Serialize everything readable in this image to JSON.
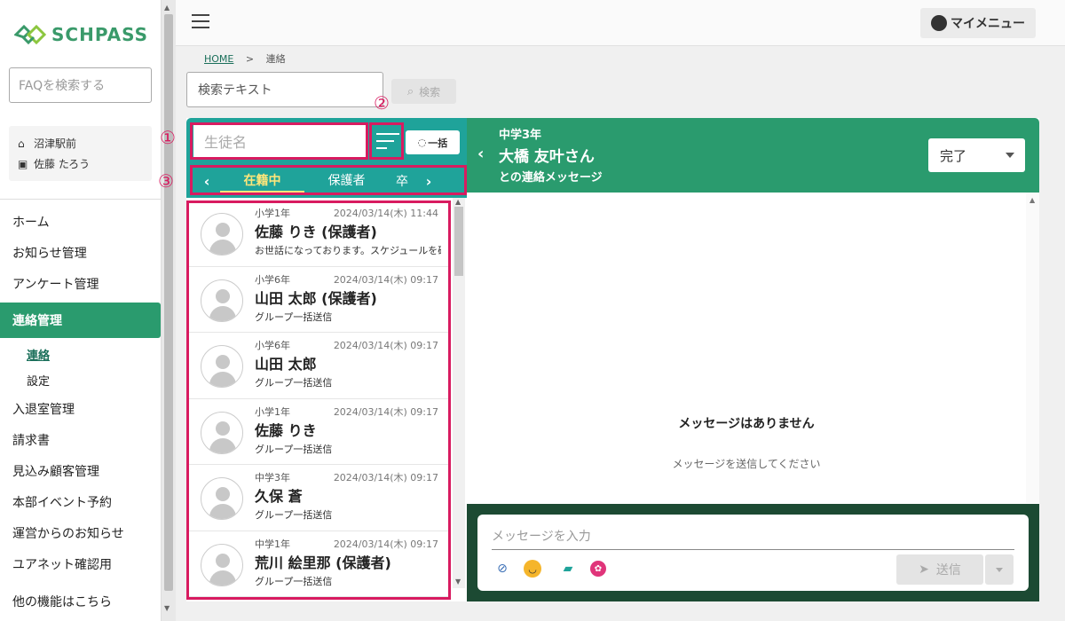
{
  "brand": {
    "name": "SCHPASS",
    "color": "#3a9a6a"
  },
  "sidebar": {
    "faq_placeholder": "FAQを検索する",
    "school": "沼津駅前",
    "user": "佐藤 たろう",
    "items": [
      {
        "label": "ホーム"
      },
      {
        "label": "お知らせ管理"
      },
      {
        "label": "アンケート管理"
      },
      {
        "label": "連絡管理"
      },
      {
        "label": "連絡"
      },
      {
        "label": "設定"
      },
      {
        "label": "入退室管理"
      },
      {
        "label": "請求書"
      },
      {
        "label": "見込み顧客管理"
      },
      {
        "label": "本部イベント予約"
      },
      {
        "label": "運営からのお知らせ"
      },
      {
        "label": "ユアネット確認用"
      },
      {
        "label": "他の機能はこちら"
      }
    ]
  },
  "header": {
    "my_menu": "マイメニュー"
  },
  "breadcrumb": {
    "home": "HOME",
    "sep": ">",
    "current": "連絡"
  },
  "search": {
    "placeholder": "検索テキスト",
    "button": "検索"
  },
  "left": {
    "student_placeholder": "生徒名",
    "bulk_button": "一括",
    "tabs": [
      {
        "label": "在籍中"
      },
      {
        "label": "保護者"
      },
      {
        "label": "卒"
      }
    ],
    "annotations": {
      "a1": "①",
      "a2": "②",
      "a3": "③"
    },
    "items": [
      {
        "grade": "小学1年",
        "date": "2024/03/14(木) 11:44",
        "name": "佐藤 りき (保護者)",
        "msg": "お世話になっております。スケジュールを確..."
      },
      {
        "grade": "小学6年",
        "date": "2024/03/14(木) 09:17",
        "name": "山田 太郎 (保護者)",
        "msg": "グループ一括送信"
      },
      {
        "grade": "小学6年",
        "date": "2024/03/14(木) 09:17",
        "name": "山田 太郎",
        "msg": "グループ一括送信"
      },
      {
        "grade": "小学1年",
        "date": "2024/03/14(木) 09:17",
        "name": "佐藤 りき",
        "msg": "グループ一括送信"
      },
      {
        "grade": "中学3年",
        "date": "2024/03/14(木) 09:17",
        "name": "久保 蒼",
        "msg": "グループ一括送信"
      },
      {
        "grade": "中学1年",
        "date": "2024/03/14(木) 09:17",
        "name": "荒川 絵里那 (保護者)",
        "msg": "グループ一括送信"
      }
    ]
  },
  "right": {
    "grade": "中学3年",
    "name": "大橋 友叶さん",
    "subtitle": "との連絡メッセージ",
    "status": "完了",
    "empty_title": "メッセージはありません",
    "empty_sub": "メッセージを送信してください",
    "compose_placeholder": "メッセージを入力",
    "send": "送信"
  }
}
